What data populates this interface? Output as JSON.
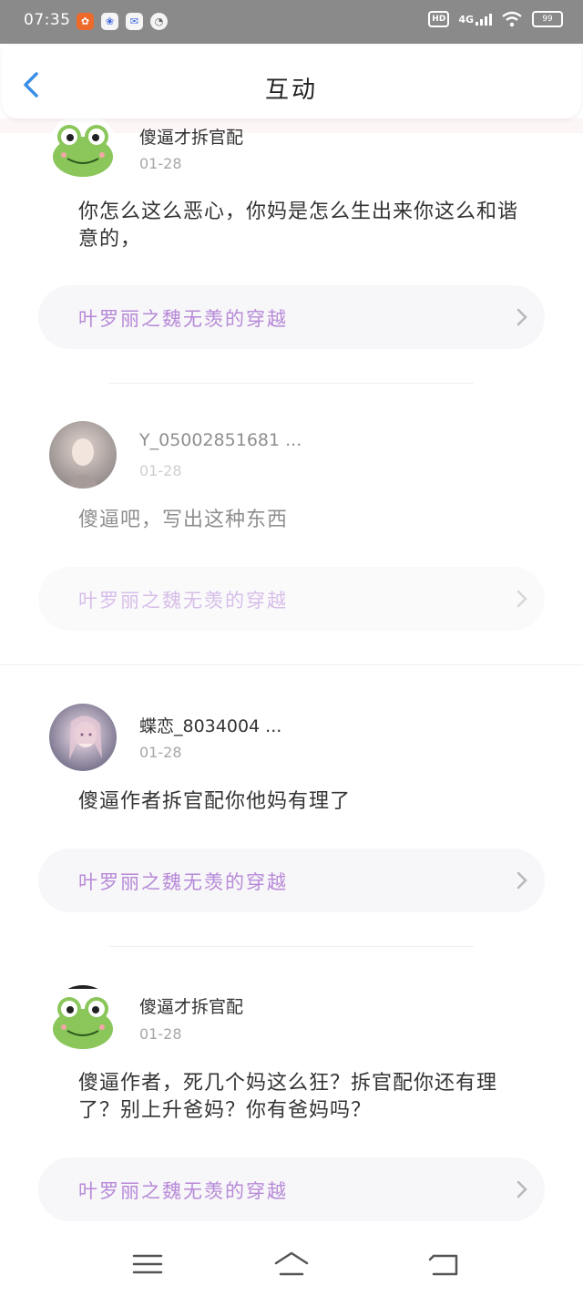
{
  "status_bar": {
    "time": "07:35",
    "network": "4G",
    "hd": "HD",
    "battery": "99"
  },
  "header": {
    "title": "互动"
  },
  "items": [
    {
      "username": "傻逼才拆官配",
      "date": "01-28",
      "content": "你怎么这么恶心，你妈是怎么生出来你这么和谐意的，",
      "book": "叶罗丽之魏无羡的穿越"
    },
    {
      "username": "Y_05002851681 ...",
      "date": "01-28",
      "content": "傻逼吧，写出这种东西",
      "book": "叶罗丽之魏无羡的穿越"
    },
    {
      "username": "蝶恋_8034004 ...",
      "date": "01-28",
      "content": "傻逼作者拆官配你他妈有理了",
      "book": "叶罗丽之魏无羡的穿越"
    },
    {
      "username": "傻逼才拆官配",
      "date": "01-28",
      "content": "傻逼作者，死几个妈这么狂？拆官配你还有理了？别上升爸妈？你有爸妈吗？",
      "book": "叶罗丽之魏无羡的穿越"
    }
  ],
  "colors": {
    "accent": "#3a8ee6",
    "book_title": "#b78ad8",
    "date": "#a7a7a7",
    "status_bar": "#8a8a8a"
  }
}
